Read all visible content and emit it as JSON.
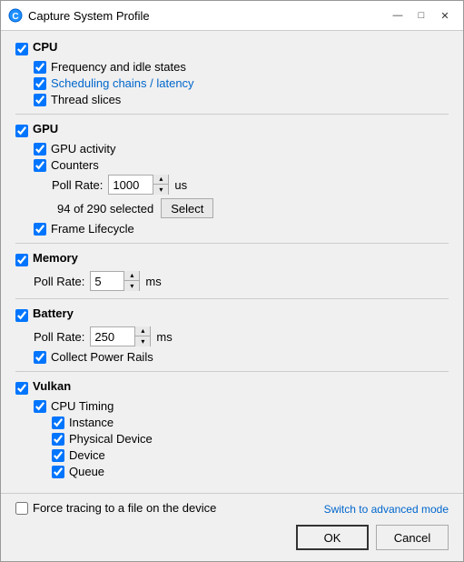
{
  "window": {
    "title": "Capture System Profile",
    "icon": "🔵"
  },
  "sections": {
    "cpu": {
      "label": "CPU",
      "items": [
        {
          "label": "Frequency and idle states",
          "checked": true
        },
        {
          "label": "Scheduling chains / latency",
          "checked": true,
          "blue": true
        },
        {
          "label": "Thread slices",
          "checked": true
        }
      ]
    },
    "gpu": {
      "label": "GPU",
      "items": [
        {
          "label": "GPU activity",
          "checked": true
        },
        {
          "label": "Counters",
          "checked": true
        }
      ],
      "pollRate": {
        "label": "Poll Rate:",
        "value": "1000",
        "unit": "us"
      },
      "selectInfo": "94 of 290 selected",
      "selectBtn": "Select",
      "frameLifecycle": {
        "label": "Frame Lifecycle",
        "checked": true
      }
    },
    "memory": {
      "label": "Memory",
      "pollRate": {
        "label": "Poll Rate:",
        "value": "5",
        "unit": "ms"
      }
    },
    "battery": {
      "label": "Battery",
      "pollRate": {
        "label": "Poll Rate:",
        "value": "250",
        "unit": "ms"
      },
      "collectPowerRails": {
        "label": "Collect Power Rails",
        "checked": true
      }
    },
    "vulkan": {
      "label": "Vulkan",
      "cpuTiming": {
        "label": "CPU Timing",
        "checked": true,
        "items": [
          {
            "label": "Instance",
            "checked": true
          },
          {
            "label": "Physical Device",
            "checked": true
          },
          {
            "label": "Device",
            "checked": true
          },
          {
            "label": "Queue",
            "checked": true
          }
        ]
      }
    }
  },
  "forceTracing": {
    "label": "Force tracing to a file on the device",
    "checked": false
  },
  "footer": {
    "advancedLink": "Switch to advanced mode",
    "okBtn": "OK",
    "cancelBtn": "Cancel"
  }
}
